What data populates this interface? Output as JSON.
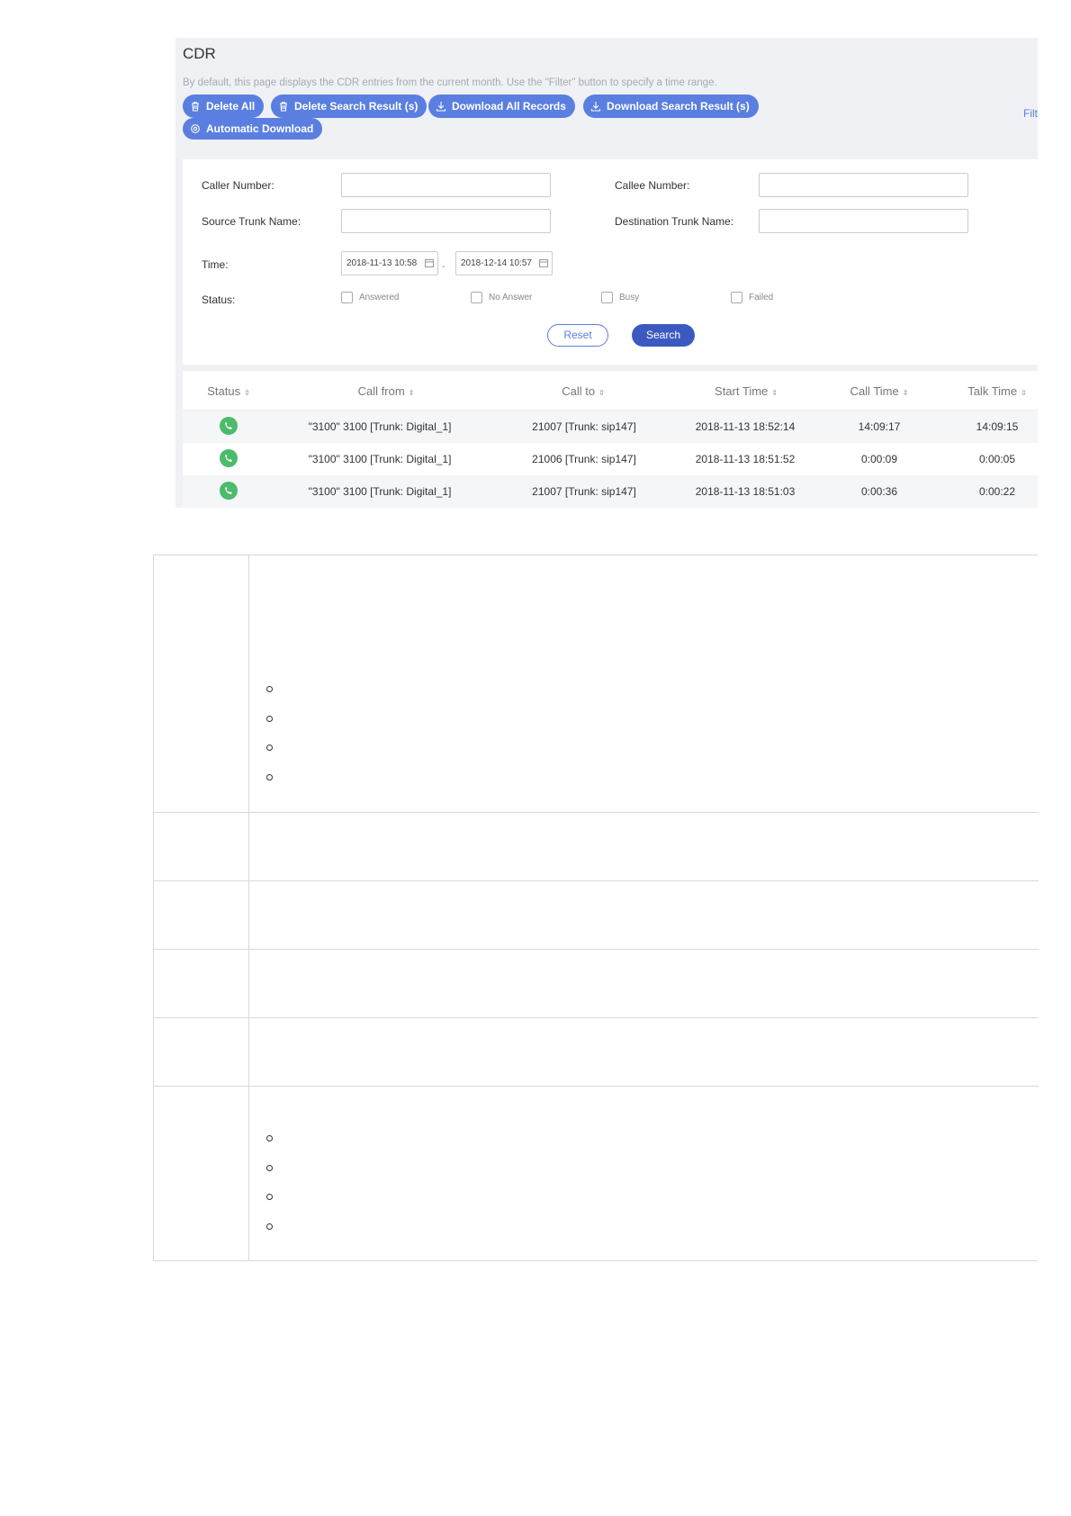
{
  "cdr": {
    "title": "CDR",
    "description": "By default, this page displays the CDR entries from the current month. Use the \"Filter\" button to specify a time range.",
    "buttons": {
      "delete_all": "Delete All",
      "delete_search": "Delete Search Result (s)",
      "download_all": "Download All Records",
      "download_search": "Download Search Result (s)",
      "automatic_download": "Automatic Download"
    },
    "filter_link": "Filt",
    "accent_color": "#5a7fe0",
    "filter": {
      "caller_number_label": "Caller Number:",
      "callee_number_label": "Callee Number:",
      "source_trunk_label": "Source Trunk Name:",
      "destination_trunk_label": "Destination Trunk Name:",
      "time_label": "Time:",
      "time_from": "2018-11-13 10:58",
      "time_to": "2018-12-14 10:57",
      "time_separator": "-",
      "status_label": "Status:",
      "status_options": [
        "Answered",
        "No Answer",
        "Busy",
        "Failed"
      ],
      "reset_label": "Reset",
      "search_label": "Search"
    },
    "table": {
      "columns": [
        "Status",
        "Call from",
        "Call to",
        "Start Time",
        "Call Time",
        "Talk Time"
      ],
      "rows": [
        {
          "status_icon": "phone-answered-icon",
          "call_from": "\"3100\" 3100 [Trunk: Digital_1]",
          "call_to": "21007 [Trunk: sip147]",
          "start_time": "2018-11-13 18:52:14",
          "call_time": "14:09:17",
          "talk_time": "14:09:15"
        },
        {
          "status_icon": "phone-answered-icon",
          "call_from": "\"3100\" 3100 [Trunk: Digital_1]",
          "call_to": "21006 [Trunk: sip147]",
          "start_time": "2018-11-13 18:51:52",
          "call_time": "0:00:09",
          "talk_time": "0:00:05"
        },
        {
          "status_icon": "phone-answered-icon",
          "call_from": "\"3100\" 3100 [Trunk: Digital_1]",
          "call_to": "21007 [Trunk: sip147]",
          "start_time": "2018-11-13 18:51:03",
          "call_time": "0:00:36",
          "talk_time": "0:00:22"
        }
      ]
    }
  }
}
